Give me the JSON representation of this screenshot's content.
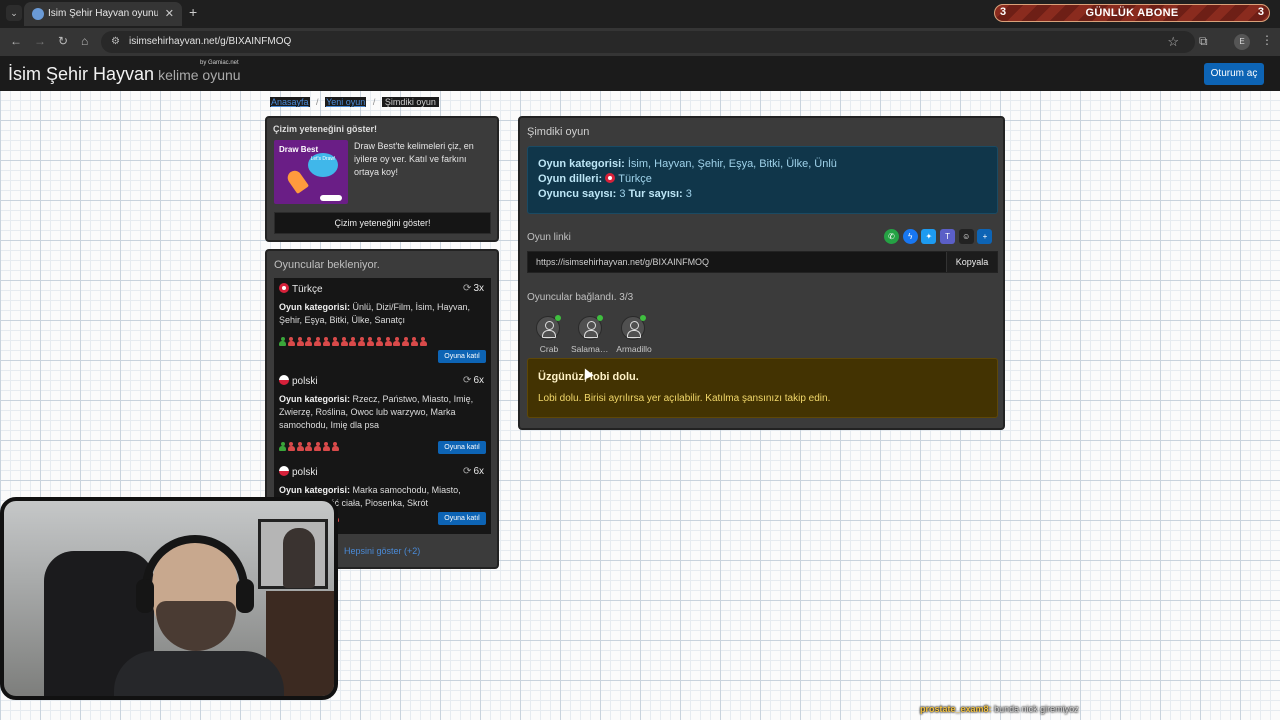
{
  "browser": {
    "tab_title": "İsim Şehir Hayvan oyununa katıl",
    "tab_close": "✕",
    "new_tab": "+",
    "tab_menu": "⌄",
    "url": "isimsehirhayvan.net/g/BIXAINFMOQ",
    "profile_initial": "E",
    "icons": [
      "back-icon",
      "forward-icon",
      "reload-icon",
      "home-icon",
      "site-info-icon",
      "star-icon",
      "extensions-icon",
      "menu-icon"
    ]
  },
  "overlay_banner": {
    "left_count": "3",
    "text": "GÜNLÜK ABONE",
    "right_count": "3"
  },
  "site": {
    "brand": "İsim Şehir Hayvan",
    "brand_sub": "kelime oyunu",
    "by": "by Gamiac.net",
    "login": "Oturum aç"
  },
  "breadcrumb": {
    "home": "Anasayfa",
    "new_game": "Yeni oyun",
    "sep": "/",
    "current": "Şimdiki oyun"
  },
  "promo": {
    "title": "Çizim yeteneğini göster!",
    "image_label": "Draw Best",
    "bubble": "Let's Draw!",
    "text": "Draw Best'te kelimeleri çiz, en iyilere oy ver. Katıl ve farkını ortaya koy!",
    "button": "Çizim yeteneğini göster!"
  },
  "players_panel": {
    "title": "Oyuncular bekleniyor.",
    "join_label": "Oyuna katıl",
    "show_all": "Hepsini göster (+2)",
    "games": [
      {
        "language": "Türkçe",
        "flag": "tr",
        "rounds": "3x",
        "category_label": "Oyun kategorisi:",
        "categories": "Ünlü, Dizi/Film, İsim, Hayvan, Şehir, Eşya, Bitki, Ülke, Sanatçı",
        "filled_slots": 1,
        "empty_slots": 16
      },
      {
        "language": "polski",
        "flag": "pl",
        "rounds": "6x",
        "category_label": "Oyun kategorisi:",
        "categories": "Rzecz, Państwo, Miasto, Imię, Zwierzę, Roślina, Owoc lub warzywo, Marka samochodu, Imię dla psa",
        "filled_slots": 1,
        "empty_slots": 6
      },
      {
        "language": "polski",
        "flag": "pl",
        "rounds": "6x",
        "category_label": "Oyun kategorisi:",
        "categories": "Marka samochodu, Miasto, Roślina, Część ciała, Piosenka, Skrót",
        "filled_slots": 1,
        "empty_slots": 6
      }
    ]
  },
  "current_game": {
    "title": "Şimdiki oyun",
    "category_label": "Oyun kategorisi:",
    "categories": "İsim, Hayvan, Şehir, Eşya, Bitki, Ülke, Ünlü",
    "languages_label": "Oyun dilleri:",
    "language": "Türkçe",
    "players_label": "Oyuncu sayısı:",
    "players_count": "3",
    "rounds_label": "Tur sayısı:",
    "rounds_count": "3",
    "link_label": "Oyun linki",
    "link": "https://isimsehirhayvan.net/g/BIXAINFMOQ",
    "copy": "Kopyala",
    "share_icons": [
      "whatsapp-icon",
      "messenger-icon",
      "twitter-icon",
      "teams-icon",
      "snapchat-icon",
      "share-more-icon"
    ],
    "connected_label": "Oyuncular bağlandı. 3/3",
    "players": [
      "Crab",
      "Salamander",
      "Armadillo"
    ],
    "warning_title": "Üzgünüz, lobi dolu.",
    "warning_text": "Lobi dolu. Birisi ayrılırsa yer açılabilir. Katılma şansınızı takip edin."
  },
  "chat": {
    "user": "prostate_exam8:",
    "message": "bunda nick giremiyoz"
  },
  "colors": {
    "accent": "#0d64b5",
    "info_bg": "#10364a",
    "warning_bg": "#433302",
    "slot_filled": "#3aa53a",
    "slot_empty": "#d94a4a"
  }
}
